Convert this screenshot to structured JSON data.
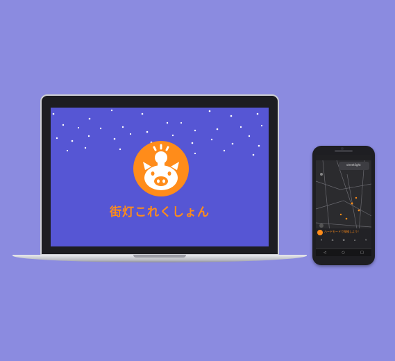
{
  "laptop": {
    "app_title": "街灯これくしょん",
    "brand_color": "#ff8c1a",
    "screen_color": "#5656d4",
    "logo_icon": "pig-with-lightbulb-icon"
  },
  "phone": {
    "nav_pill_text": "streetlight",
    "banner_text": "ハードモードで探検しよう！",
    "row_items": [
      "↑",
      "±",
      "⊕",
      "↓",
      "↑"
    ],
    "nav_buttons": [
      "◁",
      "○",
      "□"
    ],
    "status_time": "",
    "accent_color": "#ff8c1a"
  }
}
